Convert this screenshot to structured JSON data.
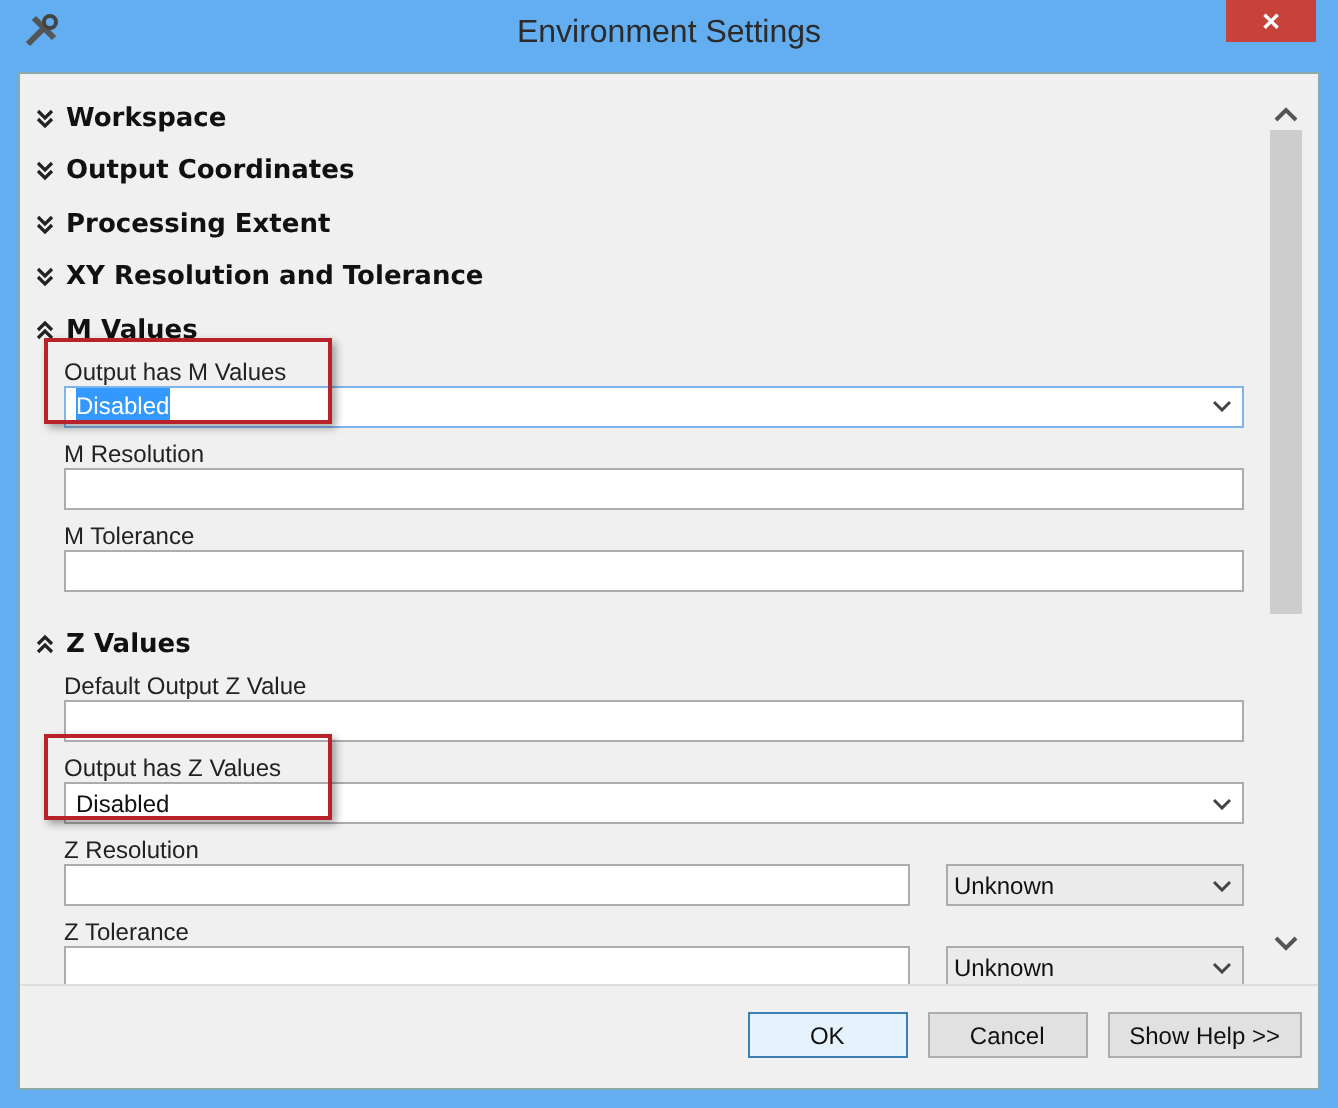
{
  "window": {
    "title": "Environment Settings",
    "close": "✕"
  },
  "sections": [
    {
      "title": "Workspace",
      "expanded": false
    },
    {
      "title": "Output Coordinates",
      "expanded": false
    },
    {
      "title": "Processing Extent",
      "expanded": false
    },
    {
      "title": "XY Resolution and Tolerance",
      "expanded": false
    },
    {
      "title": "M Values",
      "expanded": true,
      "fields": [
        {
          "kind": "dropdown",
          "label": "Output has M Values",
          "value": "Disabled",
          "text_selected": true,
          "highlighted": true
        },
        {
          "kind": "text",
          "label": "M Resolution",
          "highlighted": false
        },
        {
          "kind": "text",
          "label": "M Tolerance",
          "highlighted": false
        }
      ]
    },
    {
      "title": "Z Values",
      "expanded": true,
      "fields": [
        {
          "kind": "text",
          "label": "Default Output Z Value",
          "highlighted": false
        },
        {
          "kind": "dropdown",
          "label": "Output has Z Values",
          "value": "Disabled",
          "text_selected": false,
          "highlighted": true
        },
        {
          "kind": "text_unit",
          "label": "Z Resolution",
          "unit": "Unknown",
          "highlighted": false
        },
        {
          "kind": "text_unit",
          "label": "Z Tolerance",
          "unit": "Unknown",
          "highlighted": false
        }
      ]
    }
  ],
  "buttons": [
    {
      "label": "OK",
      "default": true
    },
    {
      "label": "Cancel",
      "default": false
    },
    {
      "label": "Show Help >>",
      "default": false
    }
  ]
}
